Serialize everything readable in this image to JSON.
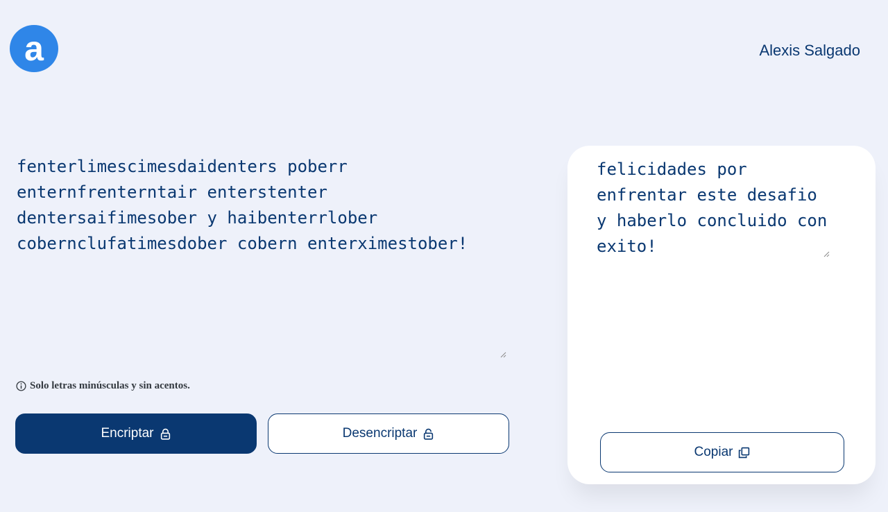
{
  "header": {
    "logo_letter": "a",
    "author": "Alexis Salgado"
  },
  "input": {
    "text": "fenterlimescimesdaidenters poberr enternfrenterntair enterstenter dentersaifimesober y haibenterrlober cobernclufatimesdober cobern enterximestober!"
  },
  "hint": {
    "text": "Solo letras minúsculas y sin acentos."
  },
  "buttons": {
    "encrypt_label": "Encriptar",
    "decrypt_label": "Desencriptar",
    "copy_label": "Copiar"
  },
  "output": {
    "text": "felicidades por enfrentar este desafio y haberlo concluido con exito!"
  },
  "colors": {
    "background": "#eef1fa",
    "primary": "#0a3871",
    "logo": "#2f86e8"
  },
  "icons": {
    "hint": "info-icon",
    "encrypt": "lock-icon",
    "decrypt": "unlock-icon",
    "copy": "copy-icon"
  }
}
